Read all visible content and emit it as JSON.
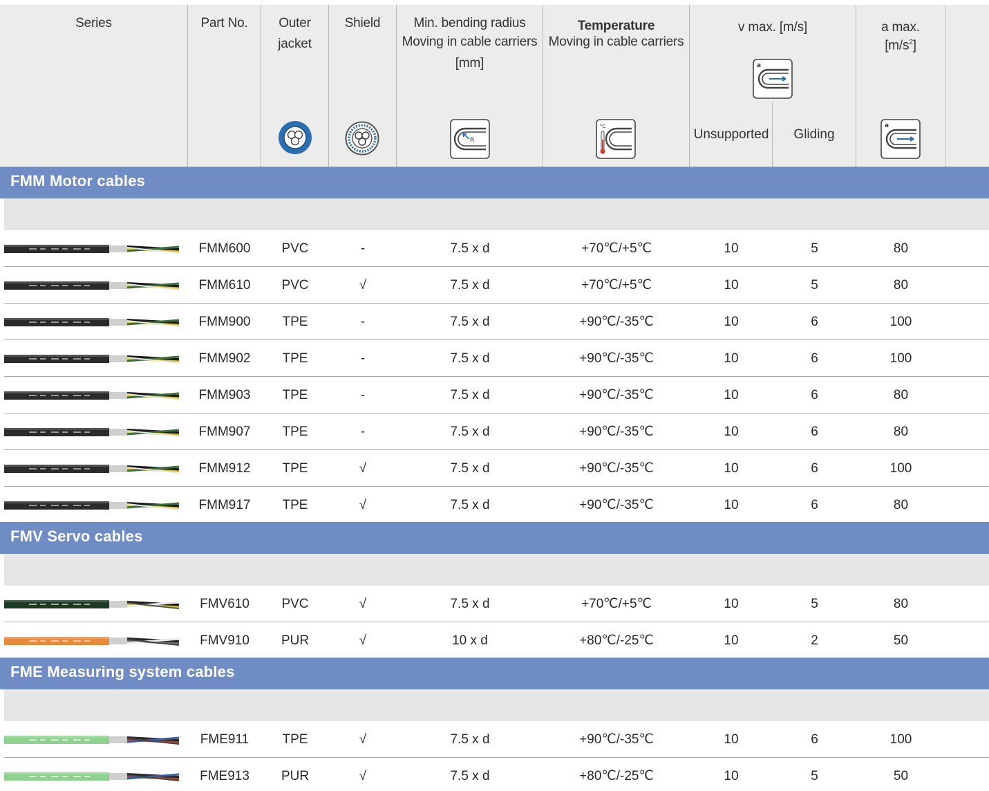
{
  "header": {
    "series": "Series",
    "part_no": "Part No.",
    "outer_jacket_line1": "Outer",
    "outer_jacket_line2": "jacket",
    "shield": "Shield",
    "bending_line1": "Min. bending radius",
    "bending_line2": "Moving in cable carriers",
    "bending_line3": "[mm]",
    "temperature_line1": "Temperature",
    "temperature_line2": "Moving in cable carriers",
    "vmax": "v max. [m/s]",
    "unsupported": "Unsupported",
    "gliding": "Gliding",
    "amax_line1": "a max.",
    "amax_line2": "[m/s",
    "amax_sup": "2",
    "amax_close": "]",
    "icon_letter_a": "a",
    "icon_letter_r": "R",
    "icon_celsius": "°C"
  },
  "colors": {
    "section_band": "#6f8cc5",
    "gray_band": "#e6e6e6",
    "header_bg": "#ececec",
    "icon_blue": "#2c6fb0"
  },
  "sections": [
    {
      "title": "FMM Motor cables",
      "rows": [
        {
          "cable_icon": "black-motor-cable",
          "part": "FMM600",
          "jacket": "PVC",
          "shield": "-",
          "radius": "7.5 x d",
          "temp": "+70℃/+5℃",
          "unsupported": "10",
          "gliding": "5",
          "amax": "80"
        },
        {
          "cable_icon": "black-motor-cable",
          "part": "FMM610",
          "jacket": "PVC",
          "shield": "√",
          "radius": "7.5 x d",
          "temp": "+70℃/+5℃",
          "unsupported": "10",
          "gliding": "5",
          "amax": "80"
        },
        {
          "cable_icon": "black-motor-cable",
          "part": "FMM900",
          "jacket": "TPE",
          "shield": "-",
          "radius": "7.5 x d",
          "temp": "+90℃/-35℃",
          "unsupported": "10",
          "gliding": "6",
          "amax": "100"
        },
        {
          "cable_icon": "black-motor-cable",
          "part": "FMM902",
          "jacket": "TPE",
          "shield": "-",
          "radius": "7.5 x d",
          "temp": "+90℃/-35℃",
          "unsupported": "10",
          "gliding": "6",
          "amax": "100"
        },
        {
          "cable_icon": "black-motor-cable",
          "part": "FMM903",
          "jacket": "TPE",
          "shield": "-",
          "radius": "7.5 x d",
          "temp": "+90℃/-35℃",
          "unsupported": "10",
          "gliding": "6",
          "amax": "80"
        },
        {
          "cable_icon": "black-motor-cable",
          "part": "FMM907",
          "jacket": "TPE",
          "shield": "-",
          "radius": "7.5 x d",
          "temp": "+90℃/-35℃",
          "unsupported": "10",
          "gliding": "6",
          "amax": "80"
        },
        {
          "cable_icon": "black-motor-cable",
          "part": "FMM912",
          "jacket": "TPE",
          "shield": "√",
          "radius": "7.5 x d",
          "temp": "+90℃/-35℃",
          "unsupported": "10",
          "gliding": "6",
          "amax": "100"
        },
        {
          "cable_icon": "black-motor-cable",
          "part": "FMM917",
          "jacket": "TPE",
          "shield": "√",
          "radius": "7.5 x d",
          "temp": "+90℃/-35℃",
          "unsupported": "10",
          "gliding": "6",
          "amax": "80"
        }
      ]
    },
    {
      "title": "FMV Servo cables",
      "rows": [
        {
          "cable_icon": "green-servo-cable",
          "part": "FMV610",
          "jacket": "PVC",
          "shield": "√",
          "radius": "7.5 x d",
          "temp": "+70℃/+5℃",
          "unsupported": "10",
          "gliding": "5",
          "amax": "80"
        },
        {
          "cable_icon": "orange-servo-cable",
          "part": "FMV910",
          "jacket": "PUR",
          "shield": "√",
          "radius": "10 x d",
          "temp": "+80℃/-25℃",
          "unsupported": "10",
          "gliding": "2",
          "amax": "50"
        }
      ]
    },
    {
      "title": "FME Measuring system cables",
      "rows": [
        {
          "cable_icon": "lightgreen-measuring-cable",
          "part": "FME911",
          "jacket": "TPE",
          "shield": "√",
          "radius": "7.5 x d",
          "temp": "+90℃/-35℃",
          "unsupported": "10",
          "gliding": "6",
          "amax": "100"
        },
        {
          "cable_icon": "lightgreen-measuring-cable",
          "part": "FME913",
          "jacket": "PUR",
          "shield": "√",
          "radius": "7.5 x d",
          "temp": "+80℃/-25℃",
          "unsupported": "10",
          "gliding": "5",
          "amax": "50"
        }
      ]
    }
  ]
}
